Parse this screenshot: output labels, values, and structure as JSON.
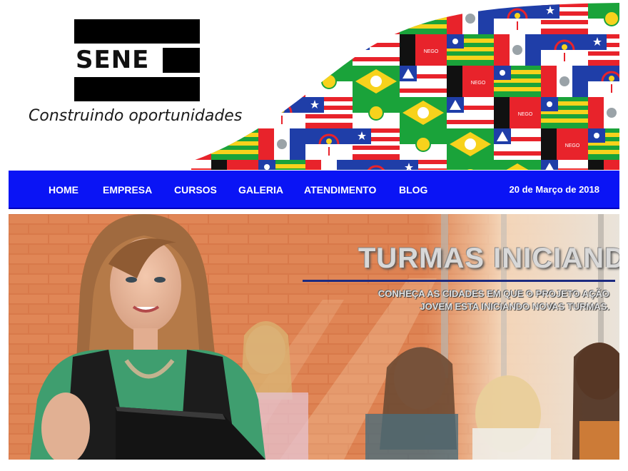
{
  "brand": {
    "logo_text": "SENE",
    "tagline": "Construindo oportunidades"
  },
  "banner": {
    "flag_label": "NEGO",
    "colors": {
      "red": "#e8232b",
      "green": "#1aa33a",
      "yellow": "#f7d21c",
      "blue": "#1f3ea8",
      "white": "#ffffff",
      "black": "#111111"
    }
  },
  "nav": {
    "items": [
      {
        "label": "HOME"
      },
      {
        "label": "EMPRESA"
      },
      {
        "label": "CURSOS"
      },
      {
        "label": "GALERIA"
      },
      {
        "label": "ATENDIMENTO"
      },
      {
        "label": "BLOG"
      }
    ],
    "date": "20 de Março de 2018",
    "background": "#0a14f5"
  },
  "hero": {
    "title": "TURMAS INICIANDO",
    "subtitle_line1": "CONHEÇA AS CIDADES EM QUE O PROJETO AÇÃO",
    "subtitle_line2": "JOVEM ESTA INICIANDO NOVAS TURMAS."
  }
}
